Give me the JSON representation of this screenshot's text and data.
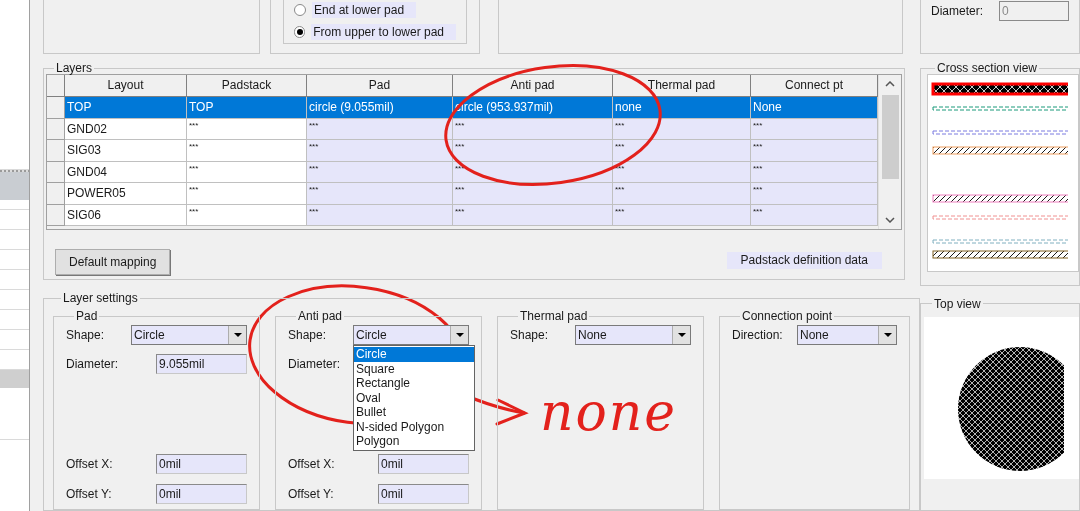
{
  "top_panel": {
    "radio_options": [
      {
        "label": "End at lower pad",
        "selected": false
      },
      {
        "label": "From upper to lower pad",
        "selected": true
      }
    ],
    "diameter": {
      "label": "Diameter:",
      "value": "0",
      "disabled": true
    }
  },
  "layers": {
    "title": "Layers",
    "columns": [
      {
        "label": "Layout",
        "editable": false
      },
      {
        "label": "Padstack",
        "editable": false
      },
      {
        "label": "Pad",
        "editable": true
      },
      {
        "label": "Anti pad",
        "editable": true
      },
      {
        "label": "Thermal pad",
        "editable": true
      },
      {
        "label": "Connect pt",
        "editable": true
      }
    ],
    "rows": [
      {
        "selected": true,
        "cells": [
          "TOP",
          "TOP",
          "circle (9.055mil)",
          "circle (953.937mil)",
          "none",
          "None"
        ]
      },
      {
        "selected": false,
        "cells": [
          "GND02",
          "***",
          "***",
          "***",
          "***",
          "***"
        ]
      },
      {
        "selected": false,
        "cells": [
          "SIG03",
          "***",
          "***",
          "***",
          "***",
          "***"
        ]
      },
      {
        "selected": false,
        "cells": [
          "GND04",
          "***",
          "***",
          "***",
          "***",
          "***"
        ]
      },
      {
        "selected": false,
        "cells": [
          "POWER05",
          "***",
          "***",
          "***",
          "***",
          "***"
        ]
      },
      {
        "selected": false,
        "cells": [
          "SIG06",
          "***",
          "***",
          "***",
          "***",
          "***"
        ]
      }
    ],
    "default_mapping_button": "Default mapping",
    "definition_label": "Padstack definition data"
  },
  "cross_section": {
    "title": "Cross section view"
  },
  "layer_settings": {
    "title": "Layer settings",
    "groups": [
      {
        "title": "Pad",
        "fields": [
          {
            "kind": "dropdown",
            "label": "Shape:",
            "value": "Circle"
          },
          {
            "kind": "text",
            "label": "Diameter:",
            "value": "9.055mil"
          }
        ],
        "offsets": [
          {
            "label": "Offset X:",
            "value": "0mil"
          },
          {
            "label": "Offset Y:",
            "value": "0mil"
          }
        ]
      },
      {
        "title": "Anti pad",
        "fields": [
          {
            "kind": "dropdown",
            "label": "Shape:",
            "value": "Circle",
            "open": true,
            "options": [
              {
                "label": "Circle",
                "selected": true
              },
              {
                "label": "Square",
                "selected": false
              },
              {
                "label": "Rectangle",
                "selected": false
              },
              {
                "label": "Oval",
                "selected": false
              },
              {
                "label": "Bullet",
                "selected": false
              },
              {
                "label": "N-sided Polygon",
                "selected": false
              },
              {
                "label": "Polygon",
                "selected": false
              }
            ]
          },
          {
            "kind": "label",
            "label": "Diameter:"
          }
        ],
        "offsets": [
          {
            "label": "Offset X:",
            "value": "0mil"
          },
          {
            "label": "Offset Y:",
            "value": "0mil"
          }
        ]
      },
      {
        "title": "Thermal pad",
        "fields": [
          {
            "kind": "dropdown",
            "label": "Shape:",
            "value": "None"
          }
        ]
      },
      {
        "title": "Connection point",
        "fields": [
          {
            "kind": "dropdown",
            "label": "Direction:",
            "value": "None"
          }
        ]
      }
    ]
  },
  "top_view": {
    "title": "Top view"
  },
  "annotations": [
    {
      "kind": "circle"
    },
    {
      "kind": "circle"
    },
    {
      "kind": "arrow"
    },
    {
      "kind": "handwriting",
      "text": "none"
    }
  ]
}
